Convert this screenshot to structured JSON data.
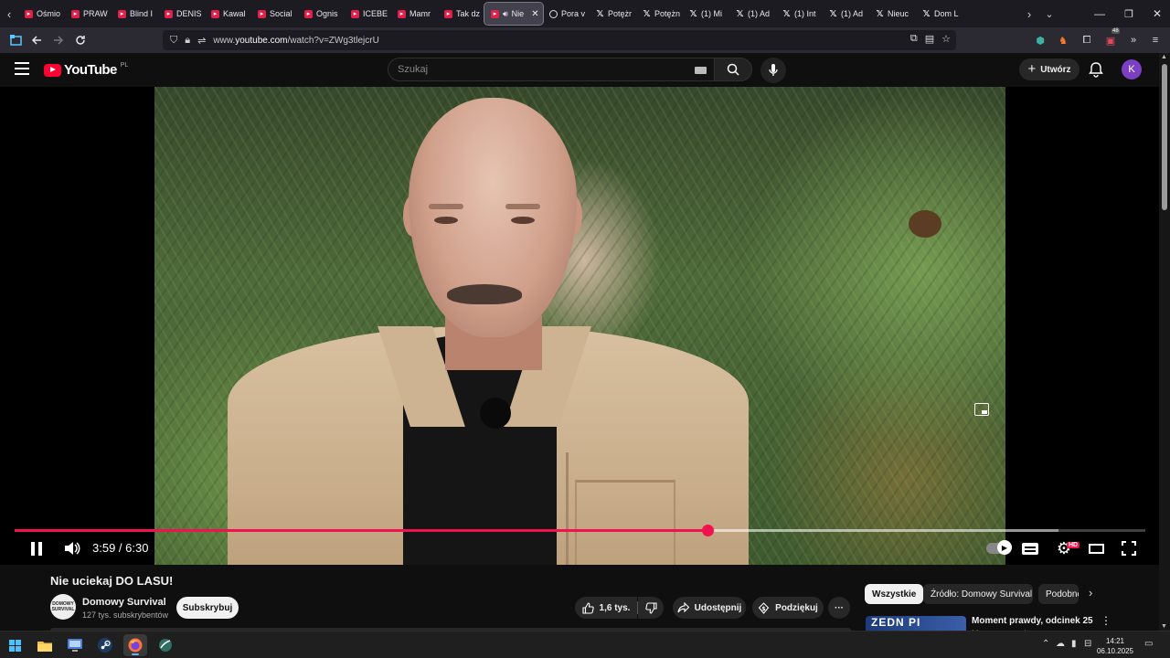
{
  "browser": {
    "tabs": [
      {
        "label": "Ośmio",
        "icon": "youtube-icon"
      },
      {
        "label": "PRAW",
        "icon": "youtube-icon"
      },
      {
        "label": "Blind I",
        "icon": "youtube-icon"
      },
      {
        "label": "DENIS",
        "icon": "youtube-icon"
      },
      {
        "label": "Kawal",
        "icon": "youtube-icon"
      },
      {
        "label": "Social",
        "icon": "youtube-icon"
      },
      {
        "label": "Ognis",
        "icon": "youtube-icon"
      },
      {
        "label": "ICEBE",
        "icon": "youtube-icon"
      },
      {
        "label": "Mamr",
        "icon": "youtube-icon"
      },
      {
        "label": "Tak dz",
        "icon": "youtube-icon"
      },
      {
        "label": "Nie",
        "icon": "youtube-icon",
        "active": true
      },
      {
        "label": "Pora v",
        "icon": "generic-icon"
      },
      {
        "label": "Potężr",
        "icon": "x-icon"
      },
      {
        "label": "Potężn",
        "icon": "x-icon"
      },
      {
        "label": "(1) Mi",
        "icon": "x-icon"
      },
      {
        "label": "(1) Ad",
        "icon": "x-icon"
      },
      {
        "label": "(1) Int",
        "icon": "x-icon"
      },
      {
        "label": "(1) Ad",
        "icon": "x-icon"
      },
      {
        "label": "Nieuc",
        "icon": "x-icon"
      },
      {
        "label": "Dom L",
        "icon": "x-icon"
      }
    ],
    "url_prefix": "www.",
    "url_domain": "youtube.com",
    "url_path": "/watch?v=ZWg3tlejcrU"
  },
  "youtube": {
    "logo_text": "YouTube",
    "country_code": "PL",
    "search_placeholder": "Szukaj",
    "create_label": "Utwórz",
    "avatar_letter": "K"
  },
  "player": {
    "current_time": "3:59",
    "duration": "6:30",
    "time_display": "3:59 / 6:30",
    "progress_fraction": 0.613,
    "buffered_fraction": 0.923,
    "quality_badge": "HD",
    "accent_color": "#f0134f"
  },
  "video": {
    "title": "Nie uciekaj DO LASU!",
    "channel_name": "Domowy Survival",
    "channel_subs": "127 tys. subskrybentów",
    "channel_avatar_text": "DOMOWY SURVIVAL",
    "subscribe_label": "Subskrybuj",
    "likes": "1,6 tys.",
    "share_label": "Udostępnij",
    "thanks_label": "Podziękuj",
    "more_label": "···"
  },
  "related": {
    "chips": [
      {
        "label": "Wszystkie",
        "active": true
      },
      {
        "label": "Źródło: Domowy Survival",
        "active": false
      },
      {
        "label": "Podobne",
        "active": false
      }
    ],
    "first_item_title": "Moment prawdy, odcinek 25",
    "first_item_channel": "Moment prawdy",
    "first_item_thumb_text": "ZEDN PI"
  },
  "taskbar": {
    "time": "14:21",
    "date": "06.10.2025",
    "ext_badge": "48"
  }
}
